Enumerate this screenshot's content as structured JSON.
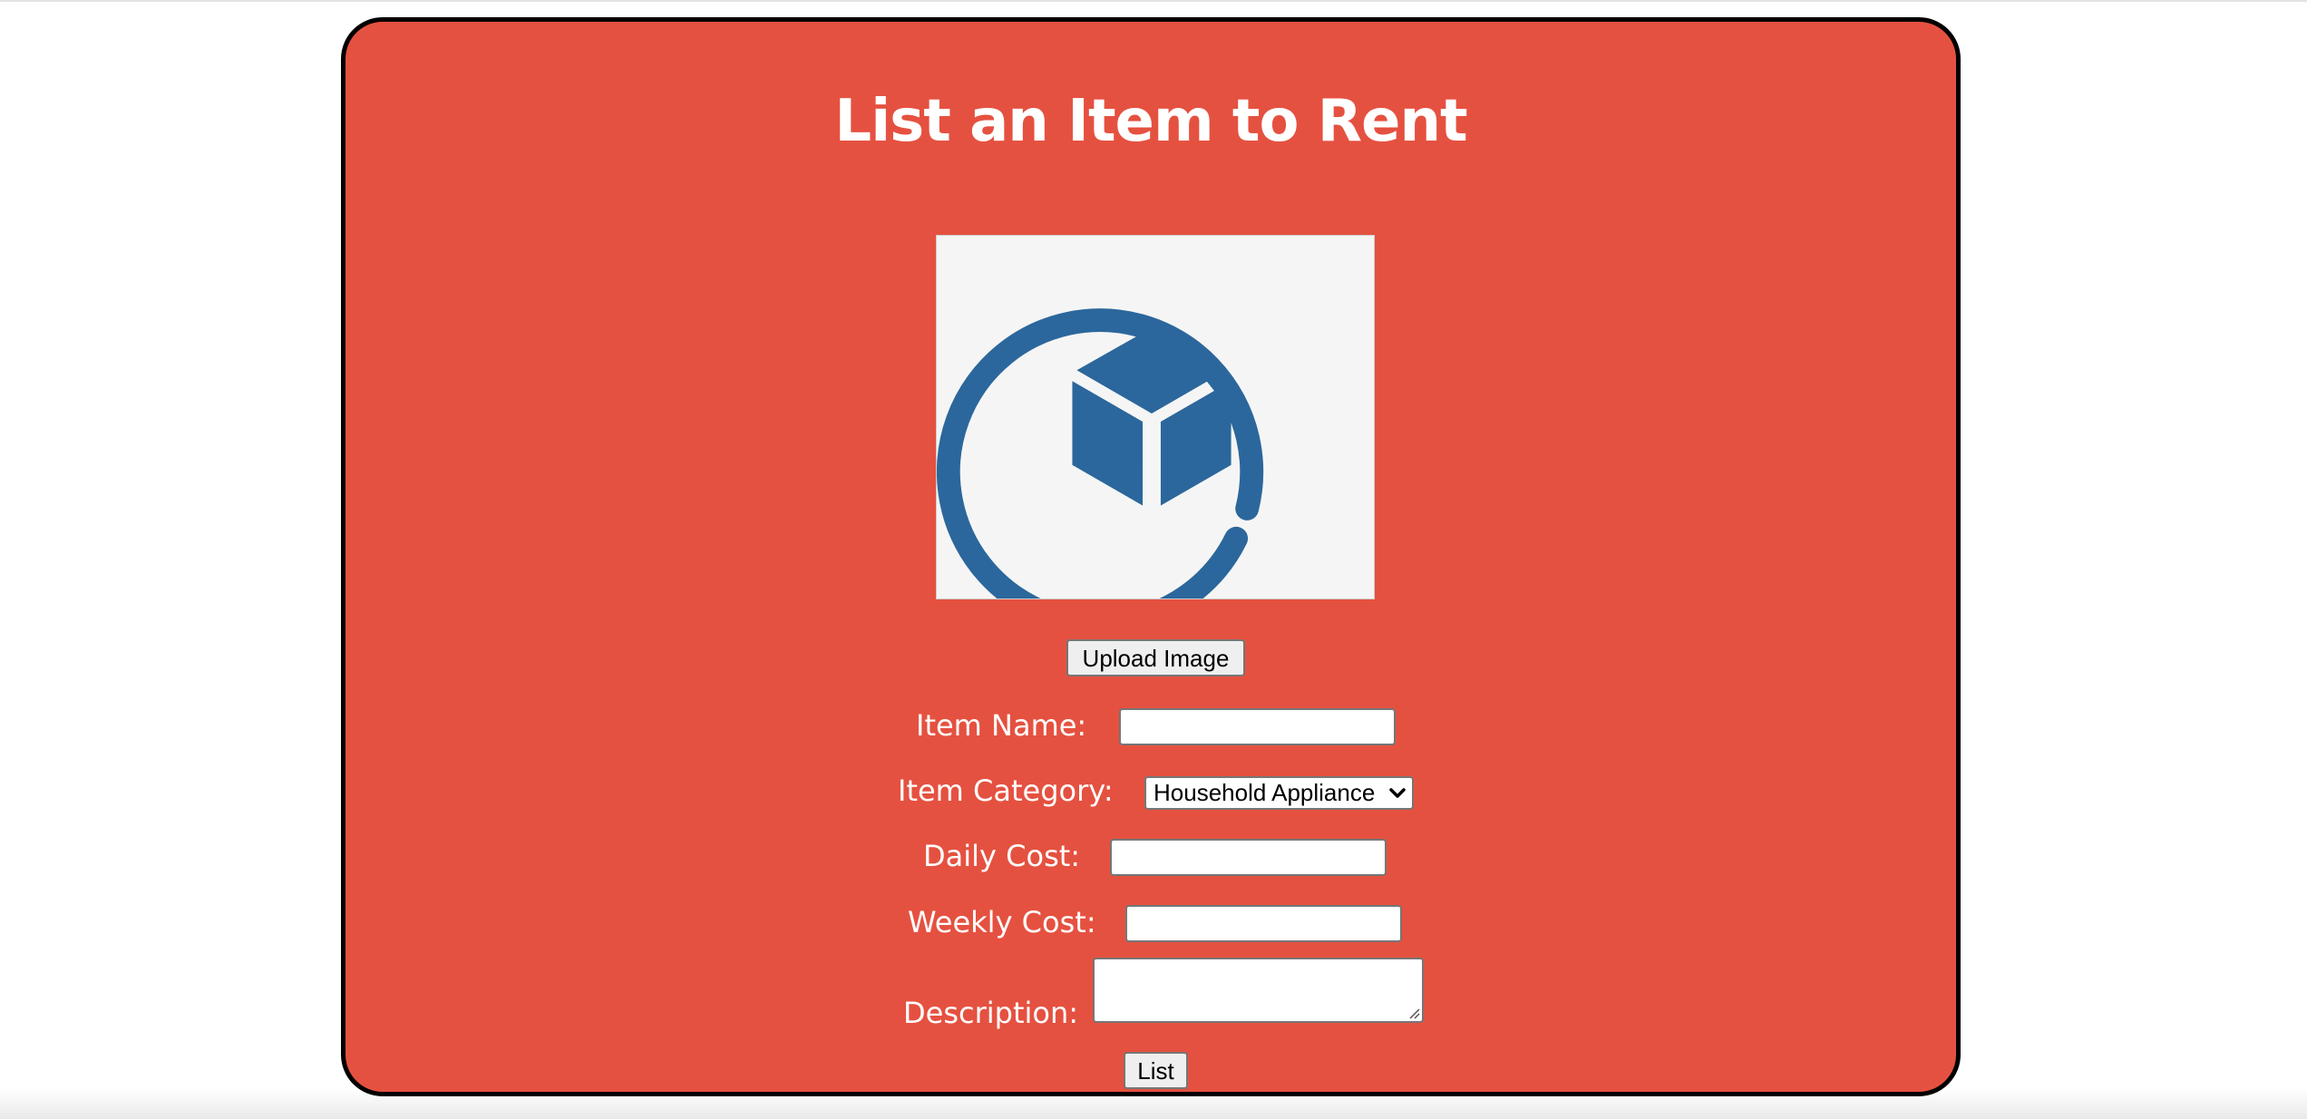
{
  "page": {
    "title": "List an Item to Rent"
  },
  "image": {
    "icon": "box-logo-icon",
    "upload_label": "Upload Image"
  },
  "form": {
    "item_name": {
      "label": "Item Name:",
      "value": ""
    },
    "item_category": {
      "label": "Item Category:",
      "selected": "Household Appliance"
    },
    "daily_cost": {
      "label": "Daily Cost:",
      "value": ""
    },
    "weekly_cost": {
      "label": "Weekly Cost:",
      "value": ""
    },
    "description": {
      "label": "Description:",
      "value": ""
    },
    "submit_label": "List"
  },
  "colors": {
    "card_background": "#e55140",
    "card_border": "#000000",
    "logo_blue": "#2b679c",
    "logo_background": "#f5f5f5",
    "text": "#ffffff"
  }
}
